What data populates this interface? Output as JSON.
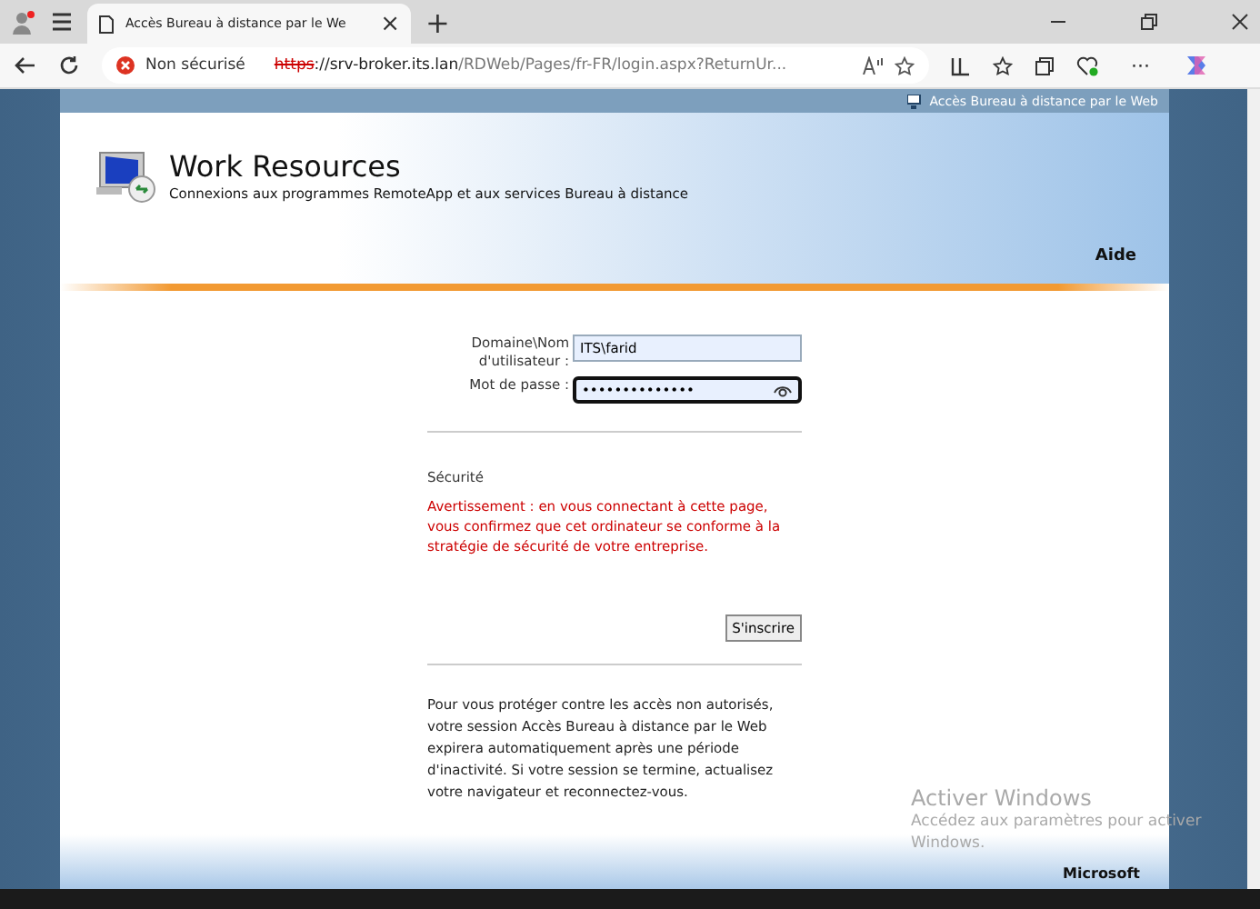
{
  "browser": {
    "tab": {
      "title": "Accès Bureau à distance par le We",
      "close": "×"
    },
    "new_tab": "+",
    "address": {
      "security": "Non sécurisé",
      "scheme": "https",
      "host": "://srv-broker.its.lan",
      "path": "/RDWeb/Pages/fr-FR/login.aspx?ReturnUr..."
    },
    "more": "···"
  },
  "page": {
    "top_link": "Accès Bureau à distance par le Web",
    "title": "Work Resources",
    "subtitle": "Connexions aux programmes RemoteApp et aux services Bureau à distance",
    "help": "Aide",
    "fields": [
      {
        "label": "Domaine\\Nom d'utilisateur :",
        "value": "ITS\\farid",
        "focused": false
      },
      {
        "label": "Mot de passe :",
        "value": "••••••••••••••",
        "focused": true
      }
    ],
    "security_title": "Sécurité",
    "warning": "Avertissement : en vous connectant à cette page, vous confirmez que cet ordinateur se conforme à la stratégie de sécurité de votre entreprise.",
    "submit": "S'inscrire",
    "notice": "Pour vous protéger contre les accès non autorisés, votre session Accès Bureau à distance par le Web expirera automatiquement après une période d'inactivité. Si votre session se termine, actualisez votre navigateur et reconnectez-vous.",
    "footer": "Microsoft"
  },
  "activation": {
    "title": "Activer Windows",
    "text": "Accédez aux paramètres pour activer Windows."
  }
}
